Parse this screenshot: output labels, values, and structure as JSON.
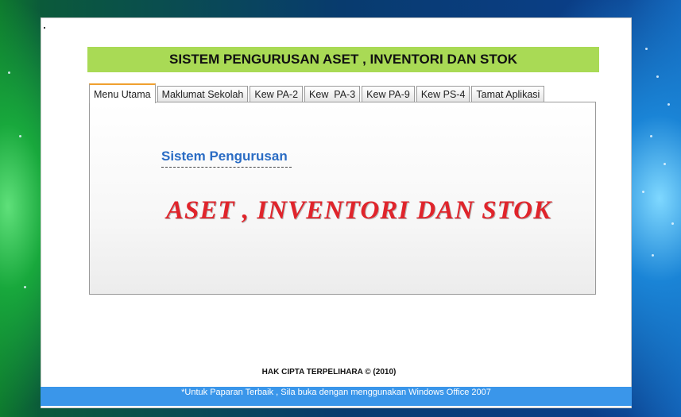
{
  "window": {
    "banner_title": "SISTEM PENGURUSAN ASET , INVENTORI DAN STOK"
  },
  "tabs": [
    {
      "label": "Menu Utama",
      "active": true
    },
    {
      "label": "Maklumat Sekolah",
      "active": false
    },
    {
      "label": "Kew PA-2",
      "active": false
    },
    {
      "label": "Kew  PA-3",
      "active": false
    },
    {
      "label": "Kew PA-9",
      "active": false
    },
    {
      "label": "Kew PS-4",
      "active": false
    },
    {
      "label": "Tamat Aplikasi",
      "active": false
    }
  ],
  "panel": {
    "subtitle": "Sistem Pengurusan",
    "big_title": "ASET , INVENTORI DAN STOK"
  },
  "copyright": "HAK CIPTA TERPELIHARA © (2010)",
  "footer_note": "*Untuk Paparan Terbaik , Sila buka dengan menggunakan Windows Office 2007",
  "colors": {
    "banner": "#a9da55",
    "subtitle": "#2a6cc4",
    "big_title": "#e0242b",
    "footer": "#3a96ea",
    "active_tab_accent": "#f0a030"
  }
}
